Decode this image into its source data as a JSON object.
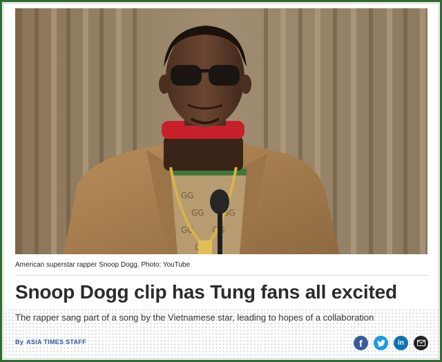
{
  "article": {
    "photo_caption": "American superstar rapper Snoop Dogg. Photo: YouTube",
    "headline": "Snoop Dogg clip has Tung fans all excited",
    "subheadline": "The rapper sang part of a song by the Vietnamese star, leading to hopes of a collaboration",
    "byline_prefix": "By",
    "byline_author": "ASIA TIMES STAFF"
  },
  "share": [
    {
      "name": "facebook",
      "glyph": "f",
      "color": "#3b5a98"
    },
    {
      "name": "twitter",
      "glyph": "t",
      "color": "#1d9ae4"
    },
    {
      "name": "linkedin",
      "glyph": "in",
      "color": "#0e73b0"
    },
    {
      "name": "email",
      "glyph": "✉",
      "color": "#222222"
    }
  ],
  "colors": {
    "frame": "#2e6b2e",
    "byline": "#2a5aa0",
    "headline": "#2b2b2b"
  }
}
